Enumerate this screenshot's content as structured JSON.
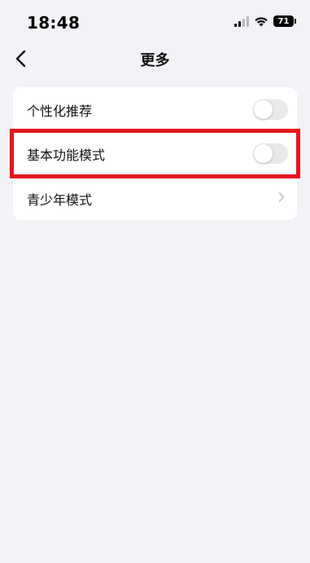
{
  "status_bar": {
    "time": "18:48",
    "battery_level": "71"
  },
  "nav": {
    "title": "更多"
  },
  "settings": {
    "rows": [
      {
        "label": "个性化推荐",
        "control": "toggle",
        "on": false
      },
      {
        "label": "基本功能模式",
        "control": "toggle",
        "on": false,
        "highlighted": true
      },
      {
        "label": "青少年模式",
        "control": "chevron"
      }
    ]
  },
  "colors": {
    "background": "#f2f2f7",
    "card": "#ffffff",
    "toggle_off": "#e9e9eb",
    "highlight": "#e8141c"
  }
}
